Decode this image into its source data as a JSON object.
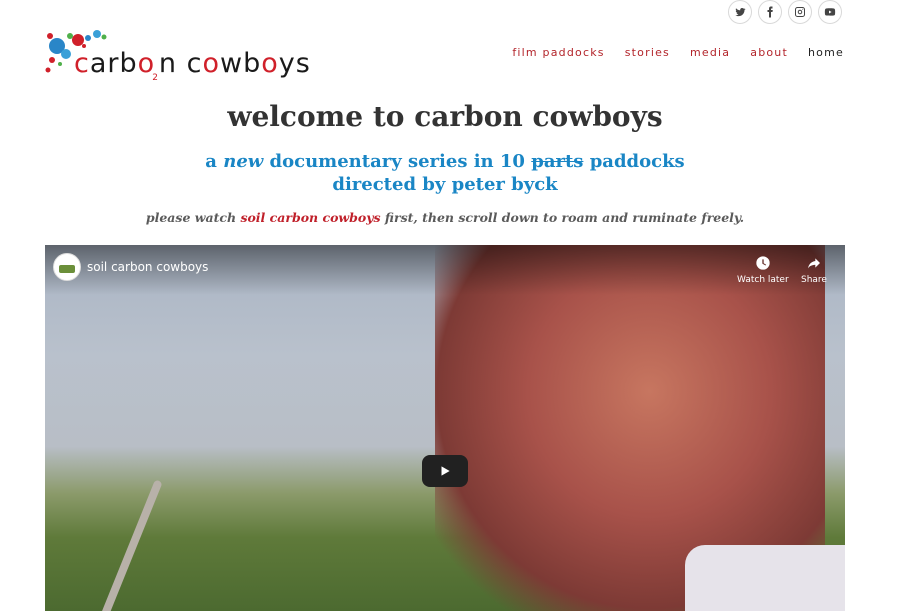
{
  "social": {
    "icons": [
      "twitter-icon",
      "facebook-icon",
      "instagram-icon",
      "youtube-icon"
    ]
  },
  "logo": {
    "part1": "c",
    "part2": "arb",
    "part3": "o",
    "part4": "2",
    "part5": "n c",
    "part6": "o",
    "part7": "wb",
    "part8": "o",
    "part9": "ys"
  },
  "nav": {
    "items": [
      "film paddocks",
      "stories",
      "media",
      "about",
      "home"
    ]
  },
  "heading": {
    "title": "welcome to carbon cowboys",
    "sub_a": "a ",
    "sub_new": "new",
    "sub_b": " documentary series in 10 ",
    "sub_strike": "parts",
    "sub_c": " paddocks",
    "sub_line2": "directed by peter byck"
  },
  "note": {
    "a": "please watch ",
    "link": "soil carbon cowboys",
    "b": " first, then scroll down to roam and ruminate freely."
  },
  "video": {
    "title": "soil carbon cowboys",
    "watch_later": "Watch later",
    "share": "Share"
  },
  "colors": {
    "nav_red": "#b3252b",
    "heading_blue": "#1a86c5",
    "accent_red": "#c0202a"
  }
}
